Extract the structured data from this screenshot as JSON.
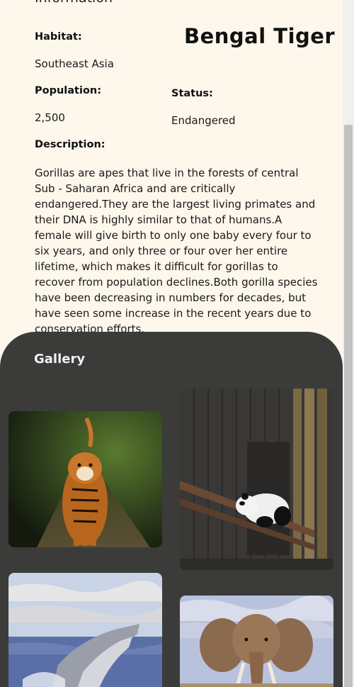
{
  "info": {
    "section_title": "Information",
    "animal_name": "Bengal Tiger",
    "habitat_label": "Habitat:",
    "habitat_value": "Southeast Asia",
    "population_label": "Population:",
    "population_value": "2,500",
    "status_label": "Status:",
    "status_value": "Endangered",
    "description_label": "Description:",
    "description_text": "Gorillas are apes that live in the forests of central Sub - Saharan Africa and are critically endangered.They are the largest living primates and their DNA is highly similar to that of humans.A female will give birth to only one baby every four to six years, and only three or four over her entire lifetime, which makes it difficult for gorillas to recover from population declines.Both gorilla species have been decreasing in numbers for decades, but have seen some increase in the recent years due to conservation efforts."
  },
  "gallery": {
    "title": "Gallery",
    "photos": [
      "tiger-photo",
      "panda-photo",
      "whale-photo",
      "elephant-photo"
    ]
  },
  "colors": {
    "info_bg": "#fdf7ec",
    "gallery_bg": "#3b3b3a"
  }
}
